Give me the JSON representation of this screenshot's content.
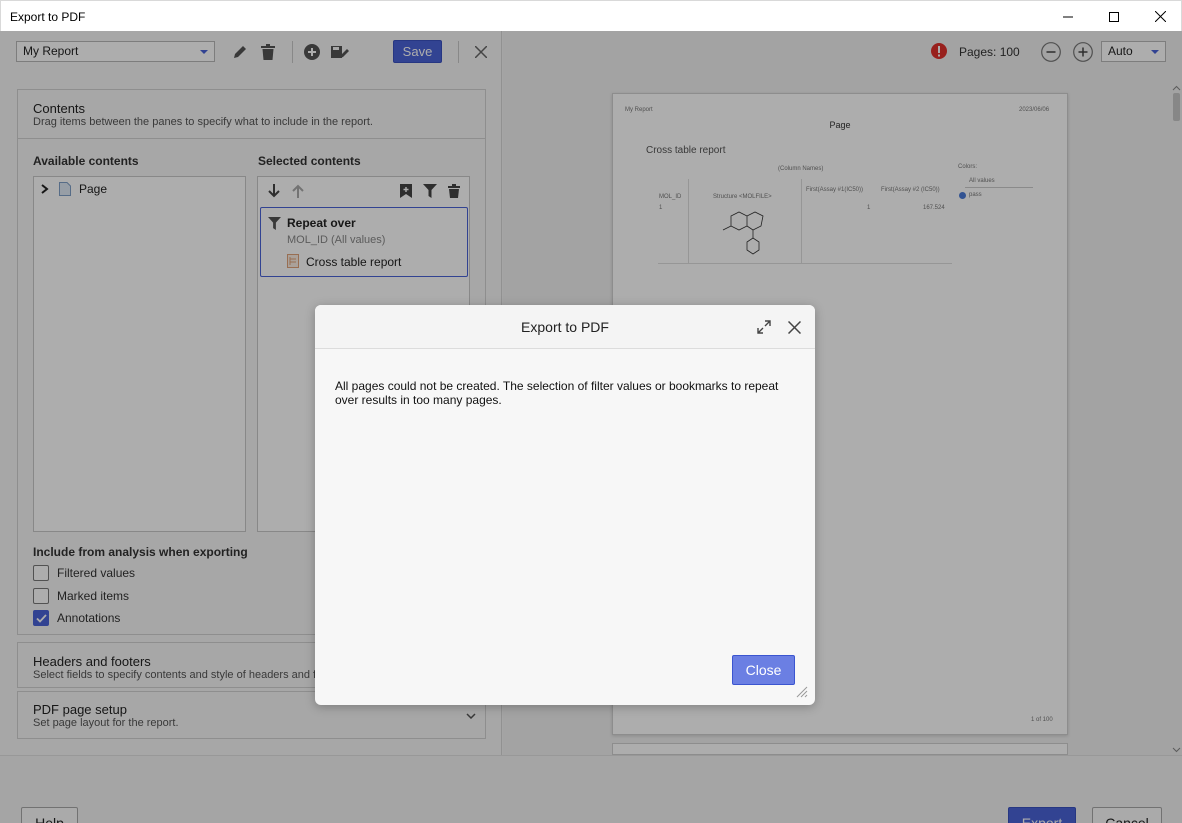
{
  "window": {
    "title": "Export to PDF"
  },
  "toolbar": {
    "report_name": "My Report",
    "save_label": "Save"
  },
  "contents": {
    "title": "Contents",
    "subtitle": "Drag items between the panes to specify what to include in the report.",
    "available_label": "Available contents",
    "selected_label": "Selected contents",
    "available_items": [
      {
        "label": "Page"
      }
    ],
    "repeat_card": {
      "title": "Repeat over",
      "subtitle": "MOL_ID (All values)",
      "child_label": "Cross table report"
    }
  },
  "include": {
    "title": "Include from analysis when exporting",
    "options": [
      {
        "label": "Filtered values",
        "checked": false
      },
      {
        "label": "Marked items",
        "checked": false
      },
      {
        "label": "Annotations",
        "checked": true
      }
    ]
  },
  "headers_footers": {
    "title": "Headers and footers",
    "subtitle": "Select fields to specify contents and style of headers and footers."
  },
  "pdf_setup": {
    "title": "PDF page setup",
    "subtitle": "Set page layout for the report."
  },
  "preview": {
    "pages_label": "Pages: 100",
    "zoom_value": "Auto",
    "page": {
      "header_left": "My Report",
      "header_right": "2023/06/06",
      "page_title": "Page",
      "report_title": "Cross table report",
      "column_names": "(Column Names)",
      "col_mol": "MOL_ID",
      "col_structure": "Structure <MOLFILE>",
      "col_assay1": "First(Assay #1(IC50))",
      "col_assay2": "First(Assay #2 (IC50))",
      "row_mol": "1",
      "row_assay1": "1",
      "row_assay2": "167.524",
      "legend_title": "Colors:",
      "legend_sub": "All values",
      "legend_item": "pass",
      "footer": "1 of 100"
    }
  },
  "bottom": {
    "help_label": "Help",
    "export_label": "Export",
    "cancel_label": "Cancel"
  },
  "modal": {
    "title": "Export to PDF",
    "message": "All pages could not be created. The selection of filter values or bookmarks to repeat over results in too many pages.",
    "close_label": "Close"
  },
  "colors": {
    "accent": "#4b63d8",
    "warning": "#e0302b"
  }
}
